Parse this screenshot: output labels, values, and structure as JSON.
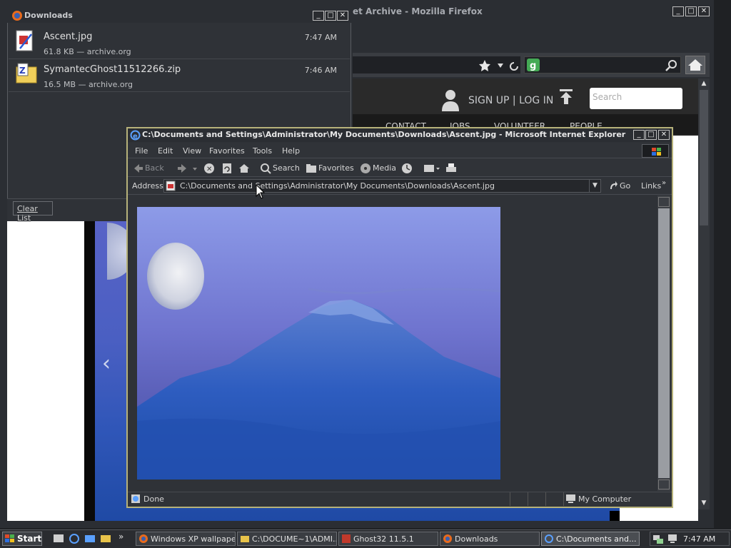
{
  "firefox": {
    "title": "et Archive - Mozilla Firefox",
    "header": {
      "signup_label": "SIGN UP | LOG IN",
      "search_placeholder": "Search"
    },
    "nav": [
      "CONTACT",
      "JOBS",
      "VOLUNTEER",
      "PEOPLE"
    ],
    "gallery_prev": "‹"
  },
  "downloads": {
    "title": "Downloads",
    "items": [
      {
        "name": "Ascent.jpg",
        "meta": "61.8 KB — archive.org",
        "time": "7:47 AM",
        "icon": "image-file-icon"
      },
      {
        "name": "SymantecGhost11512266.zip",
        "meta": "16.5 MB — archive.org",
        "time": "7:46 AM",
        "icon": "zip-file-icon"
      }
    ],
    "clear_label": "Clear List"
  },
  "ie": {
    "title": "C:\\Documents and Settings\\Administrator\\My Documents\\Downloads\\Ascent.jpg - Microsoft Internet Explorer",
    "menu": [
      "File",
      "Edit",
      "View",
      "Favorites",
      "Tools",
      "Help"
    ],
    "toolbar": {
      "back": "Back",
      "search": "Search",
      "favorites": "Favorites",
      "media": "Media"
    },
    "address_label": "Address",
    "address_value": "C:\\Documents and Settings\\Administrator\\My Documents\\Downloads\\Ascent.jpg",
    "go_label": "Go",
    "links_label": "Links",
    "status": "Done",
    "zone": "My Computer"
  },
  "taskbar": {
    "start_label": "Start",
    "tasks": [
      {
        "label": "Windows XP wallpape...",
        "active": false
      },
      {
        "label": "C:\\DOCUME~1\\ADMI...",
        "active": false
      },
      {
        "label": "Ghost32 11.5.1",
        "active": false
      },
      {
        "label": "Downloads",
        "active": false
      },
      {
        "label": "C:\\Documents and...",
        "active": true
      }
    ],
    "clock": "7:47 AM"
  },
  "colors": {
    "title_active_border": "#b7b27a",
    "dark_bg": "#2f3237",
    "photo_sky": "#7a86e0",
    "photo_mountain": "#2b57b8"
  }
}
